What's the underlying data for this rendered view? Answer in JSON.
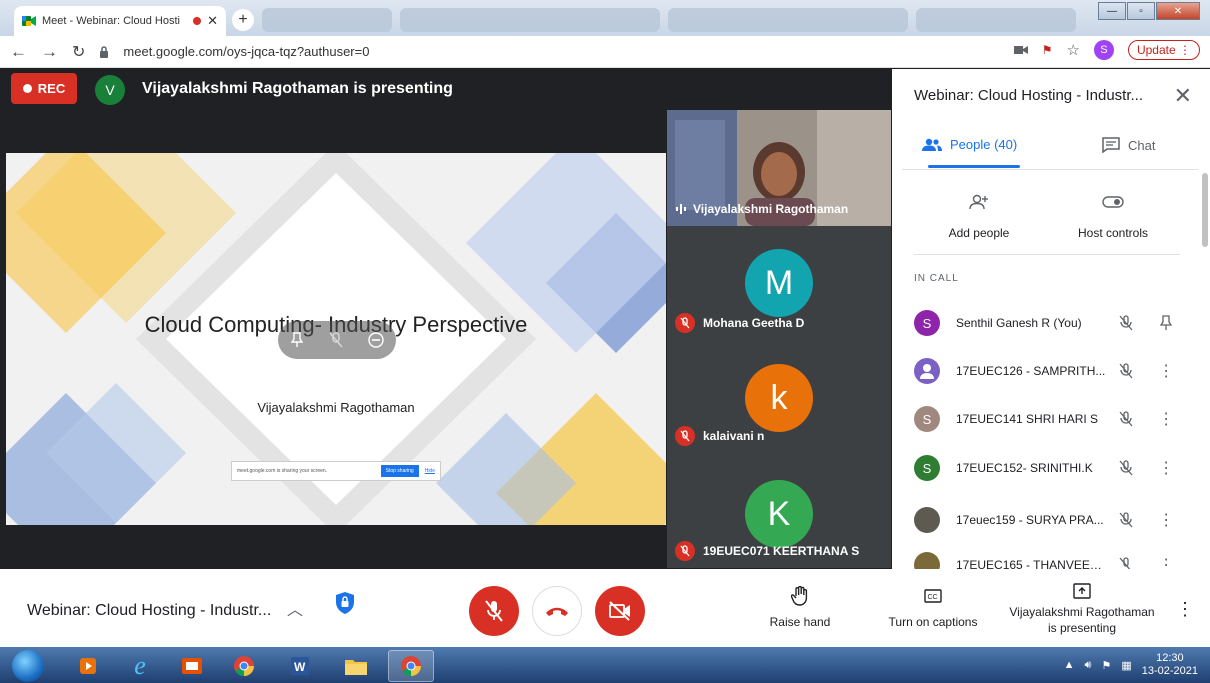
{
  "browser": {
    "tab_title": "Meet - Webinar: Cloud Hosti",
    "url": "meet.google.com/oys-jqca-tqz?authuser=0",
    "profile_initial": "S",
    "update_label": "Update"
  },
  "meet": {
    "rec_label": "REC",
    "presenter_initial": "V",
    "presenting_text": "Vijayalakshmi Ragothaman is presenting",
    "slide": {
      "title": "Cloud Computing- Industry Perspective",
      "subtitle": "Vijayalakshmi Ragothaman",
      "share_notice": "meet.google.com is sharing your screen.",
      "stop_sharing": "Stop sharing",
      "hide": "Hide"
    },
    "tiles": [
      {
        "name": "Vijayalakshmi Ragothaman"
      },
      {
        "name": "Mohana Geetha D",
        "initial": "M",
        "color": "#12a4af"
      },
      {
        "name": "kalaivani n",
        "initial": "k",
        "color": "#e8710a"
      },
      {
        "name": "19EUEC071 KEERTHANA S",
        "initial": "K",
        "color": "#34a853"
      }
    ]
  },
  "panel": {
    "title": "Webinar: Cloud Hosting - Industr...",
    "tab_people": "People (40)",
    "tab_chat": "Chat",
    "add_people": "Add people",
    "host_controls": "Host controls",
    "in_call": "IN CALL",
    "participants": [
      {
        "name": "Senthil Ganesh R (You)",
        "initial": "S",
        "color": "#8e24aa"
      },
      {
        "name": "17EUEC126 - SAMPRITH...",
        "initial": "",
        "color": "#7b61c4"
      },
      {
        "name": "17EUEC141 SHRI HARI S",
        "initial": "S",
        "color": "#a1887f"
      },
      {
        "name": "17EUEC152- SRINITHI.K",
        "initial": "S",
        "color": "#2e7d32"
      },
      {
        "name": "17euec159 - SURYA PRA...",
        "initial": "",
        "color": "#5d5a52"
      },
      {
        "name": "17EUEC165 - THANVEER...",
        "initial": "",
        "color": "#7a6a3a"
      }
    ]
  },
  "bottom": {
    "meeting_name": "Webinar: Cloud Hosting - Industr...",
    "raise_hand": "Raise hand",
    "captions": "Turn on captions",
    "presenting_line1": "Vijayalakshmi Ragothaman",
    "presenting_line2": "is presenting"
  },
  "taskbar": {
    "time": "12:30",
    "date": "13-02-2021"
  }
}
